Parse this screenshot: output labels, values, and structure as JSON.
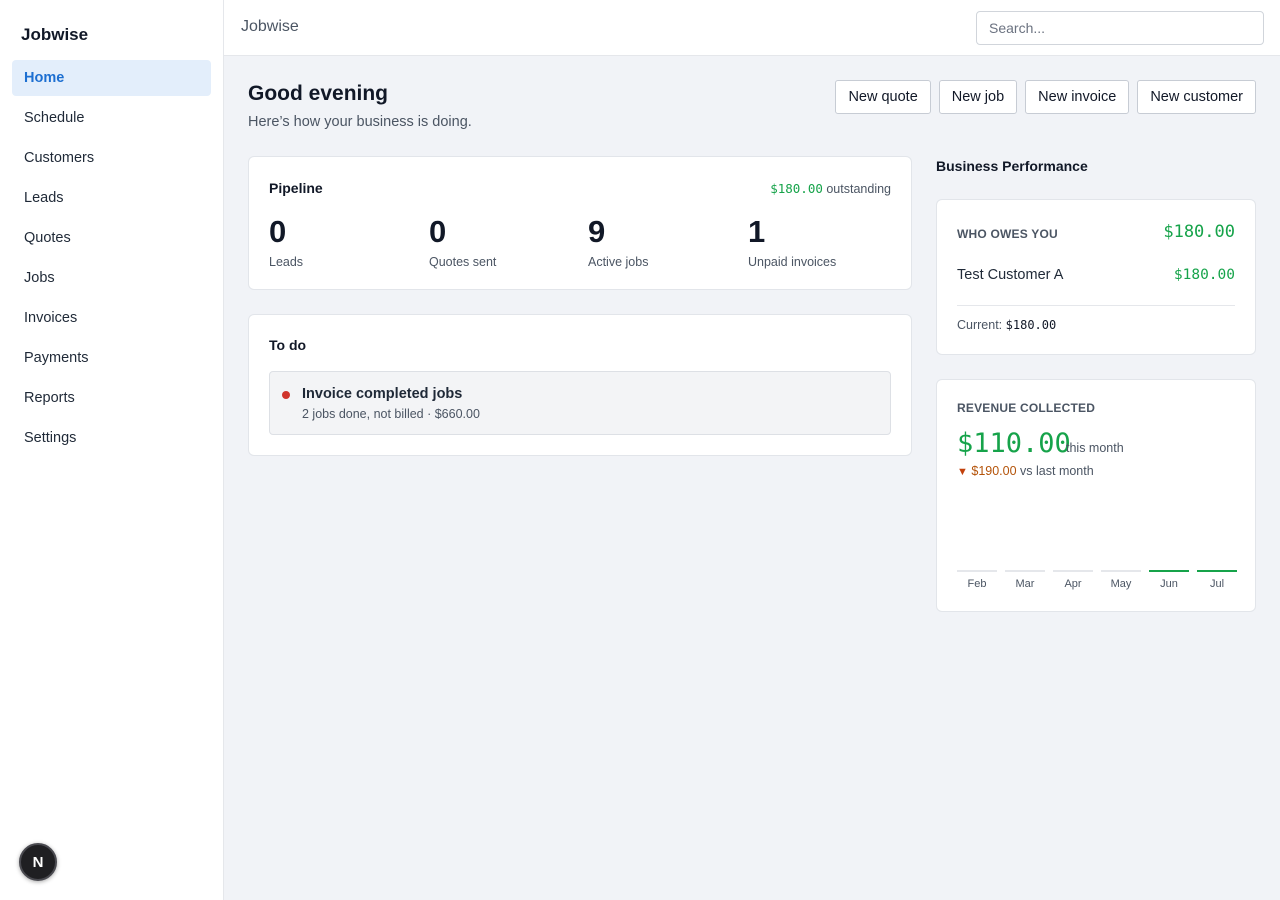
{
  "app": {
    "brand": "Jobwise",
    "header_title": "Jobwise"
  },
  "sidebar": {
    "items": [
      {
        "label": "Home",
        "active": true
      },
      {
        "label": "Schedule"
      },
      {
        "label": "Customers"
      },
      {
        "label": "Leads"
      },
      {
        "label": "Quotes"
      },
      {
        "label": "Jobs"
      },
      {
        "label": "Invoices"
      },
      {
        "label": "Payments"
      },
      {
        "label": "Reports"
      },
      {
        "label": "Settings"
      }
    ],
    "badge": "N"
  },
  "search": {
    "placeholder": "Search..."
  },
  "greeting": {
    "title": "Good evening",
    "subtitle": "Here’s how your business is doing."
  },
  "actions": [
    "New quote",
    "New job",
    "New invoice",
    "New customer"
  ],
  "pipeline": {
    "title": "Pipeline",
    "outstanding_amount": "$180.00",
    "outstanding_label": "outstanding",
    "stats": [
      {
        "value": "0",
        "label": "Leads"
      },
      {
        "value": "0",
        "label": "Quotes sent"
      },
      {
        "value": "9",
        "label": "Active jobs"
      },
      {
        "value": "1",
        "label": "Unpaid invoices"
      }
    ]
  },
  "todo": {
    "title": "To do",
    "items": [
      {
        "title": "Invoice completed jobs",
        "subtitle": "2 jobs done, not billed · $660.00"
      }
    ]
  },
  "performance": {
    "title": "Business Performance",
    "owes": {
      "label": "WHO OWES YOU",
      "total": "$180.00",
      "customer_name": "Test Customer A",
      "customer_amount": "$180.00",
      "current_label": "Current:",
      "current_amount": "$180.00"
    },
    "revenue": {
      "label": "REVENUE COLLECTED",
      "amount": "$110.00",
      "suffix": "this month",
      "change_arrow": "▼",
      "change_amount": "$190.00",
      "change_label": "vs last month"
    }
  },
  "colors": {
    "accent": "#1d6fd1",
    "positive": "#16a34a",
    "negative": "#b45309",
    "alert_dot": "#d0342c"
  },
  "chart_data": {
    "type": "bar",
    "categories": [
      "Feb",
      "Mar",
      "Apr",
      "May",
      "Jun",
      "Jul"
    ],
    "values": [
      0,
      0,
      0,
      0,
      110,
      110
    ],
    "highlight": [
      false,
      false,
      false,
      false,
      true,
      true
    ],
    "title": "",
    "xlabel": "",
    "ylabel": ""
  }
}
